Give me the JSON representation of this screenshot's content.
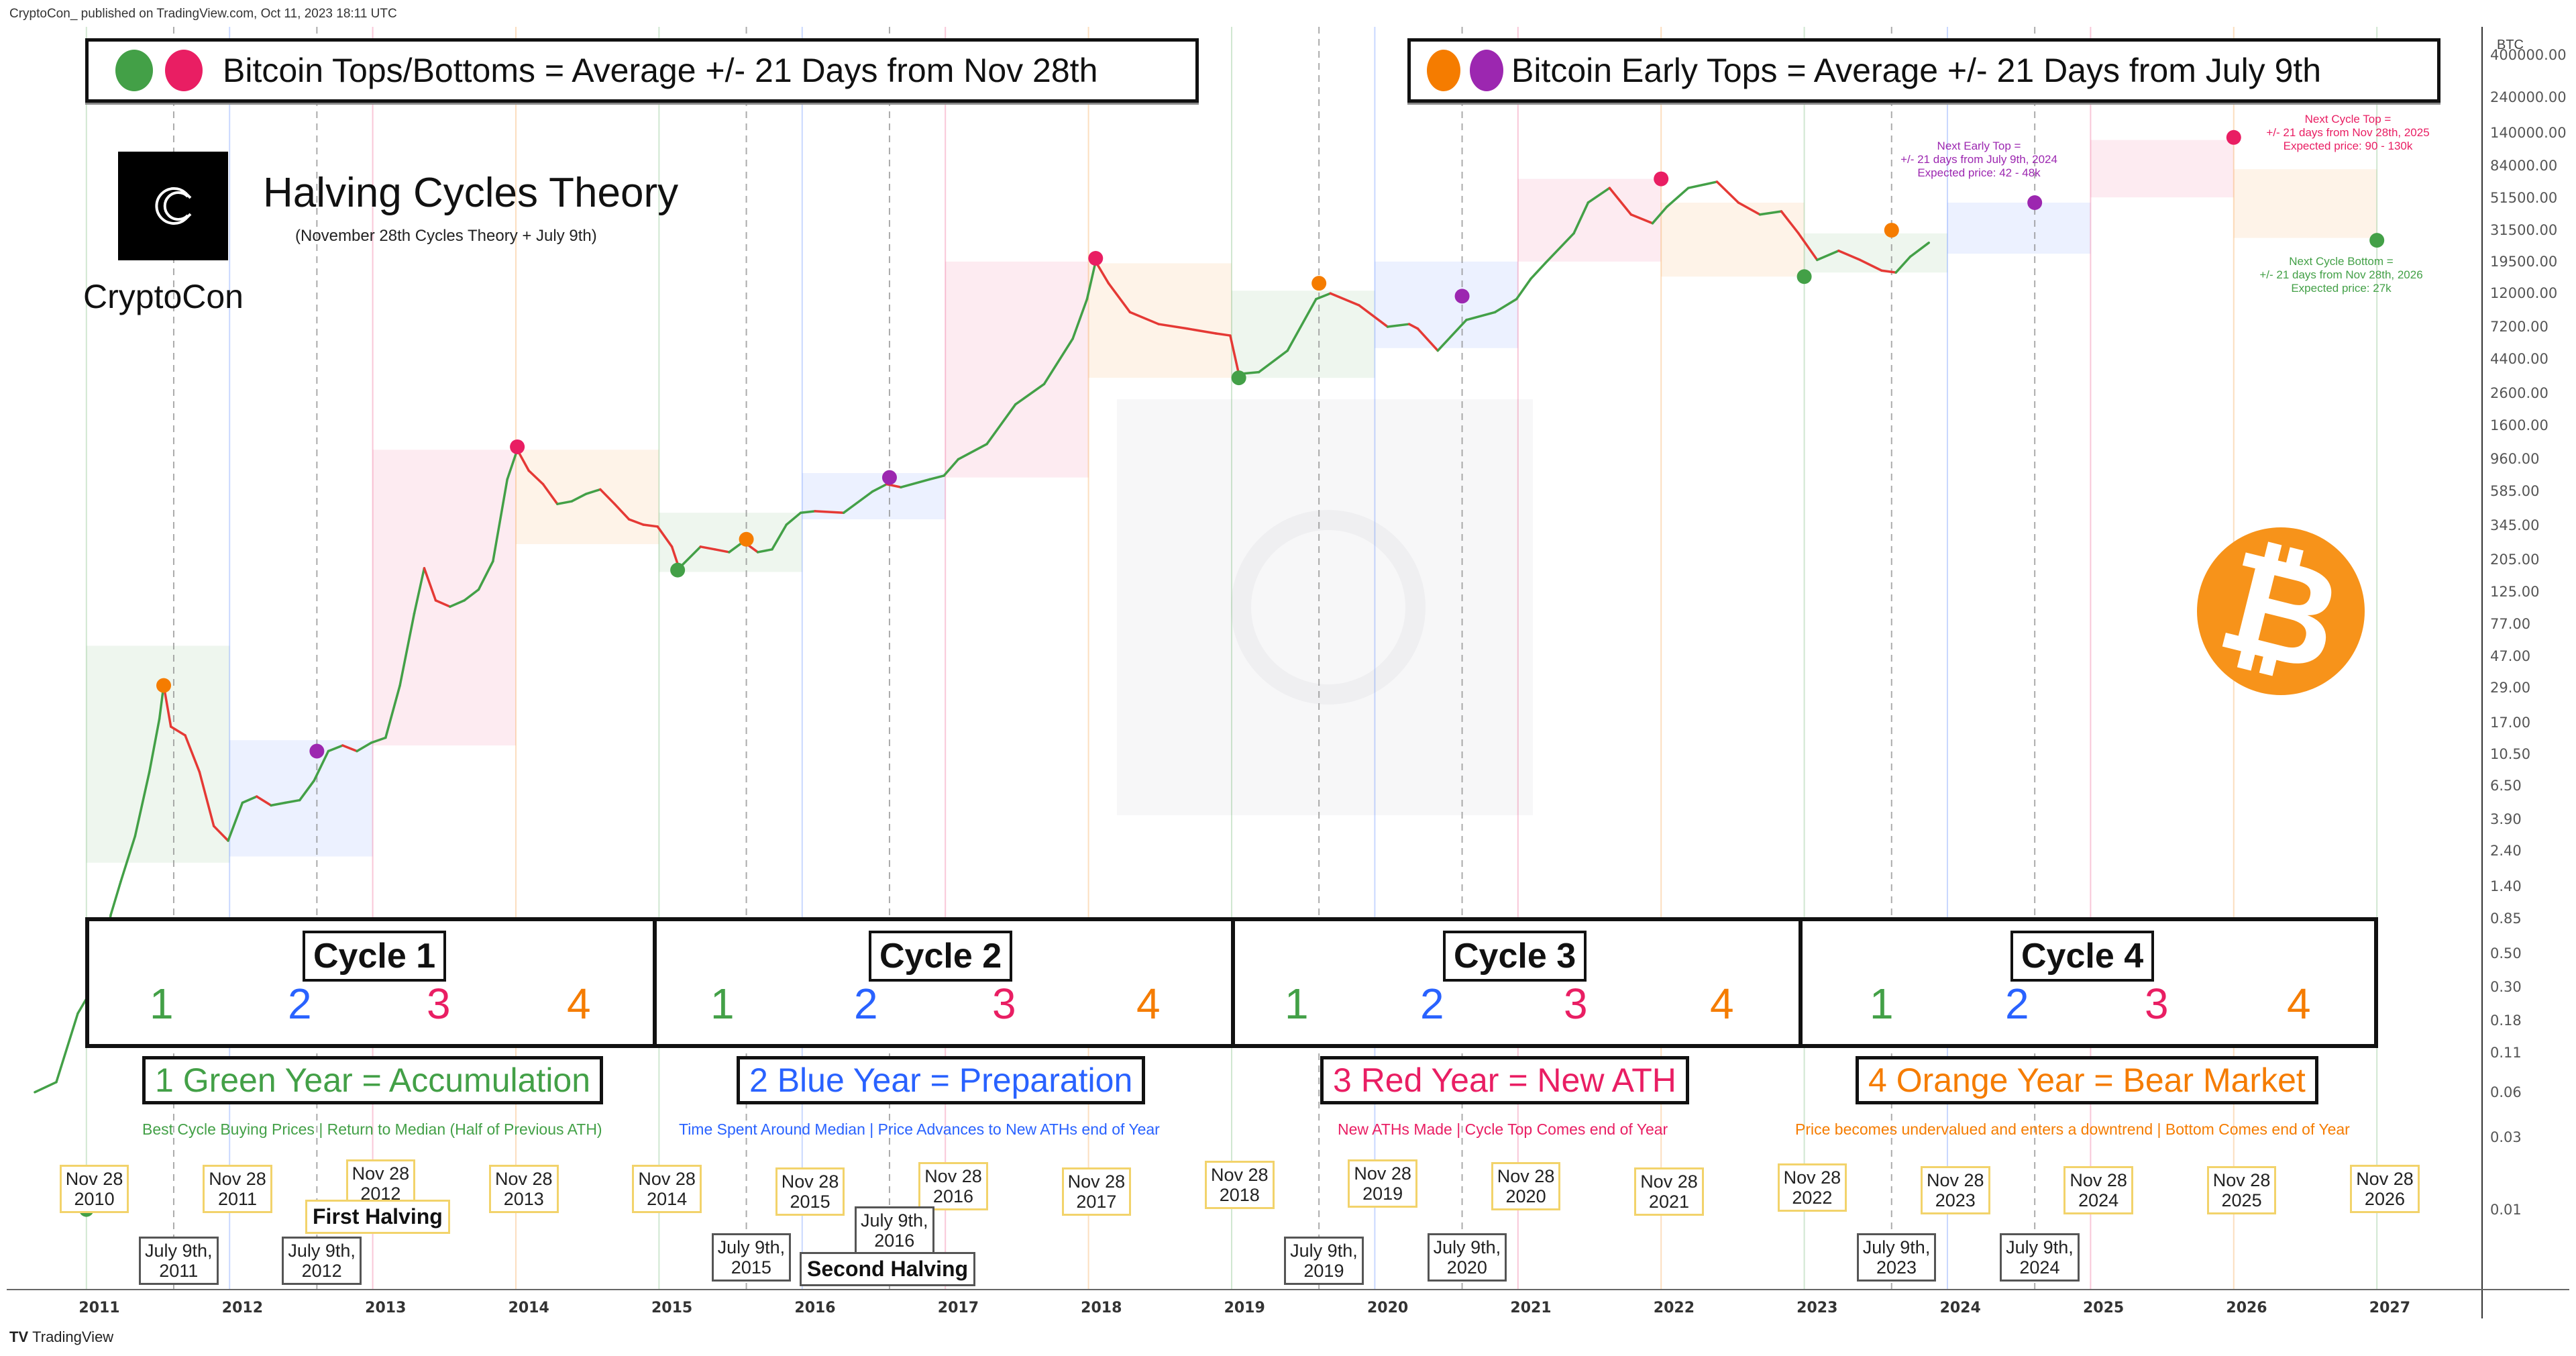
{
  "header": {
    "publisher_line": "CryptoCon_ published on TradingView.com, Oct 11, 2023 18:11 UTC",
    "footer_brand": "TradingView",
    "footer_logo_icon": "tradingview-logo-icon"
  },
  "legends": {
    "tops_bottoms": {
      "text": "Bitcoin Tops/Bottoms = Average +/- 21 Days from Nov 28th",
      "dot_colors": [
        "#43a047",
        "#e91e63"
      ]
    },
    "early_tops": {
      "text": "Bitcoin  Early Tops = Average +/- 21 Days from July 9th",
      "dot_colors": [
        "#f57c00",
        "#9c27b0"
      ]
    }
  },
  "branding": {
    "logo_icon": "cryptocon-logo-icon",
    "name": "CryptoCon",
    "title": "Halving Cycles Theory",
    "subtitle": "(November 28th Cycles Theory + July 9th)",
    "bitcoin_icon": "bitcoin-logo-icon",
    "bitcoin_glyph": "₿"
  },
  "colors": {
    "green": "#43a047",
    "blue": "#2962ff",
    "red": "#e91e63",
    "orange": "#f57c00",
    "purple": "#9c27b0",
    "up_candle": "#26a69a",
    "down_candle": "#ef5350"
  },
  "cycles": [
    {
      "label": "Cycle 1",
      "phases": [
        "1",
        "2",
        "3",
        "4"
      ]
    },
    {
      "label": "Cycle 2",
      "phases": [
        "1",
        "2",
        "3",
        "4"
      ]
    },
    {
      "label": "Cycle 3",
      "phases": [
        "1",
        "2",
        "3",
        "4"
      ]
    },
    {
      "label": "Cycle 4",
      "phases": [
        "1",
        "2",
        "3",
        "4"
      ]
    }
  ],
  "year_types": [
    {
      "title": "1 Green Year = Accumulation",
      "desc": "Best Cycle Buying Prices | Return to Median (Half of Previous ATH)",
      "color": "#43a047"
    },
    {
      "title": "2 Blue Year = Preparation",
      "desc": "Time Spent Around Median | Price Advances to New ATHs end of Year",
      "color": "#2962ff"
    },
    {
      "title": "3 Red Year = New ATH",
      "desc": "New ATHs Made | Cycle Top Comes end of Year",
      "color": "#e91e63"
    },
    {
      "title": "4 Orange Year = Bear Market",
      "desc": "Price becomes undervalued and enters a downtrend | Bottom Comes end of Year",
      "color": "#f57c00"
    }
  ],
  "nov28_labels": [
    {
      "line1": "Nov 28",
      "line2": "2010"
    },
    {
      "line1": "Nov 28",
      "line2": "2011"
    },
    {
      "line1": "Nov 28",
      "line2": "2012"
    },
    {
      "line1": "Nov 28",
      "line2": "2013"
    },
    {
      "line1": "Nov 28",
      "line2": "2014"
    },
    {
      "line1": "Nov 28",
      "line2": "2015"
    },
    {
      "line1": "Nov 28",
      "line2": "2016"
    },
    {
      "line1": "Nov 28",
      "line2": "2017"
    },
    {
      "line1": "Nov 28",
      "line2": "2018"
    },
    {
      "line1": "Nov 28",
      "line2": "2019"
    },
    {
      "line1": "Nov 28",
      "line2": "2020"
    },
    {
      "line1": "Nov 28",
      "line2": "2021"
    },
    {
      "line1": "Nov 28",
      "line2": "2022"
    },
    {
      "line1": "Nov 28",
      "line2": "2023"
    },
    {
      "line1": "Nov 28",
      "line2": "2024"
    },
    {
      "line1": "Nov 28",
      "line2": "2025"
    },
    {
      "line1": "Nov 28",
      "line2": "2026"
    }
  ],
  "july9_labels": [
    {
      "line1": "July 9th,",
      "line2": "2011"
    },
    {
      "line1": "July 9th,",
      "line2": "2012"
    },
    {
      "line1": "July 9th,",
      "line2": "2015"
    },
    {
      "line1": "July 9th,",
      "line2": "2016"
    },
    {
      "line1": "July 9th,",
      "line2": "2019"
    },
    {
      "line1": "July 9th,",
      "line2": "2020"
    },
    {
      "line1": "July 9th,",
      "line2": "2023"
    },
    {
      "line1": "July 9th,",
      "line2": "2024"
    }
  ],
  "halvings": [
    {
      "label": "First Halving"
    },
    {
      "label": "Second Halving"
    }
  ],
  "projections": {
    "next_early_top": {
      "line1": "Next Early Top =",
      "line2": "+/- 21 days from July 9th, 2024",
      "line3": "Expected price: 42 - 48k"
    },
    "next_cycle_top": {
      "line1": "Next Cycle Top =",
      "line2": "+/- 21 days from Nov 28th, 2025",
      "line3": "Expected price: 90 - 130k"
    },
    "next_cycle_bottom": {
      "line1": "Next Cycle Bottom =",
      "line2": "+/- 21 days from Nov 28th, 2026",
      "line3": "Expected price: 27k"
    }
  },
  "chart_data": {
    "type": "line",
    "title": "Halving Cycles Theory",
    "subtitle": "(November 28th Cycles Theory + July 9th)",
    "xlabel": "",
    "ylabel": "BTC",
    "y_scale": "log",
    "ylim": [
      0.01,
      400000
    ],
    "xlim": [
      2010.5,
      2027.6
    ],
    "grid": true,
    "x_ticks": [
      "2011",
      "2012",
      "2013",
      "2014",
      "2015",
      "2016",
      "2017",
      "2018",
      "2019",
      "2020",
      "2021",
      "2022",
      "2023",
      "2024",
      "2025",
      "2026",
      "2027"
    ],
    "y_ticks": [
      "400000.00",
      "240000.00",
      "140000.00",
      "84000.00",
      "51500.00",
      "31500.00",
      "19500.00",
      "12000.00",
      "7200.00",
      "4400.00",
      "2600.00",
      "1600.00",
      "960.00",
      "585.00",
      "345.00",
      "205.00",
      "125.00",
      "77.00",
      "47.00",
      "29.00",
      "17.00",
      "10.50",
      "6.50",
      "3.90",
      "2.40",
      "1.40",
      "0.85",
      "0.50",
      "0.30",
      "0.18",
      "0.11",
      "0.06",
      "0.03",
      "0.01"
    ],
    "y_tick_values": [
      400000,
      240000,
      140000,
      84000,
      51500,
      31500,
      19500,
      12000,
      7200,
      4400,
      2600,
      1600,
      960,
      585,
      345,
      205,
      125,
      77,
      47,
      29,
      17,
      10.5,
      6.5,
      3.9,
      2.4,
      1.4,
      0.85,
      0.5,
      0.3,
      0.18,
      0.11,
      0.06,
      0.03,
      0.01
    ],
    "series": [
      {
        "name": "BTC price",
        "x": [
          2010.55,
          2010.7,
          2010.85,
          2010.91,
          2011.0,
          2011.08,
          2011.15,
          2011.25,
          2011.35,
          2011.42,
          2011.45,
          2011.5,
          2011.6,
          2011.7,
          2011.8,
          2011.9,
          2012.0,
          2012.1,
          2012.2,
          2012.3,
          2012.4,
          2012.5,
          2012.6,
          2012.7,
          2012.8,
          2012.9,
          2013.0,
          2013.1,
          2013.2,
          2013.27,
          2013.35,
          2013.45,
          2013.55,
          2013.65,
          2013.75,
          2013.85,
          2013.92,
          2014.0,
          2014.1,
          2014.2,
          2014.3,
          2014.4,
          2014.5,
          2014.6,
          2014.7,
          2014.8,
          2014.9,
          2015.0,
          2015.05,
          2015.2,
          2015.3,
          2015.4,
          2015.5,
          2015.6,
          2015.7,
          2015.8,
          2015.9,
          2016.0,
          2016.2,
          2016.4,
          2016.5,
          2016.6,
          2016.8,
          2016.9,
          2017.0,
          2017.2,
          2017.4,
          2017.6,
          2017.8,
          2017.9,
          2017.96,
          2018.05,
          2018.2,
          2018.4,
          2018.6,
          2018.8,
          2018.9,
          2018.96,
          2019.1,
          2019.3,
          2019.5,
          2019.6,
          2019.8,
          2020.0,
          2020.15,
          2020.21,
          2020.35,
          2020.55,
          2020.75,
          2020.9,
          2021.0,
          2021.1,
          2021.3,
          2021.4,
          2021.55,
          2021.7,
          2021.85,
          2021.95,
          2022.1,
          2022.3,
          2022.45,
          2022.6,
          2022.75,
          2022.87,
          2023.0,
          2023.15,
          2023.3,
          2023.45,
          2023.55,
          2023.65,
          2023.78
        ],
        "values": [
          0.06,
          0.07,
          0.2,
          0.25,
          0.3,
          0.9,
          1.5,
          3,
          8,
          18,
          30,
          16,
          14,
          8,
          3.5,
          2.8,
          5,
          5.5,
          4.8,
          5,
          5.2,
          7,
          11,
          12,
          11,
          12.5,
          13.5,
          30,
          90,
          180,
          110,
          100,
          110,
          130,
          200,
          700,
          1100,
          800,
          650,
          480,
          500,
          560,
          600,
          480,
          380,
          350,
          340,
          250,
          180,
          250,
          240,
          230,
          270,
          230,
          240,
          350,
          420,
          430,
          420,
          580,
          650,
          620,
          700,
          740,
          950,
          1200,
          2200,
          3000,
          6000,
          11000,
          19500,
          14000,
          9000,
          7500,
          7000,
          6500,
          6300,
          3500,
          3600,
          5000,
          11000,
          12000,
          10000,
          7200,
          7500,
          7000,
          5000,
          8000,
          9000,
          11000,
          15000,
          19000,
          30000,
          48000,
          60000,
          40000,
          35000,
          45000,
          60000,
          66000,
          48000,
          40000,
          42000,
          30000,
          20000,
          23000,
          20000,
          17000,
          16500,
          21000,
          26000,
          28000,
          30000,
          29000,
          27000
        ]
      }
    ],
    "markers": [
      {
        "x": 2010.91,
        "y": 0.01,
        "type": "cycle_bottom",
        "color": "#43a047"
      },
      {
        "x": 2011.45,
        "y": 30,
        "type": "early_top",
        "color": "#f57c00"
      },
      {
        "x": 2012.52,
        "y": 11,
        "type": "early_top",
        "color": "#9c27b0"
      },
      {
        "x": 2013.92,
        "y": 1150,
        "type": "cycle_top",
        "color": "#e91e63"
      },
      {
        "x": 2015.04,
        "y": 175,
        "type": "cycle_bottom",
        "color": "#43a047"
      },
      {
        "x": 2015.52,
        "y": 280,
        "type": "early_top",
        "color": "#f57c00"
      },
      {
        "x": 2016.52,
        "y": 720,
        "type": "early_top",
        "color": "#9c27b0"
      },
      {
        "x": 2017.96,
        "y": 20500,
        "type": "cycle_top",
        "color": "#e91e63"
      },
      {
        "x": 2018.96,
        "y": 3300,
        "type": "cycle_bottom",
        "color": "#43a047"
      },
      {
        "x": 2019.52,
        "y": 14000,
        "type": "early_top",
        "color": "#f57c00"
      },
      {
        "x": 2020.52,
        "y": 11500,
        "type": "early_top",
        "color": "#9c27b0"
      },
      {
        "x": 2021.91,
        "y": 69000,
        "type": "cycle_top",
        "color": "#e91e63"
      },
      {
        "x": 2022.91,
        "y": 15500,
        "type": "cycle_bottom",
        "color": "#43a047"
      },
      {
        "x": 2023.52,
        "y": 31500,
        "type": "early_top",
        "color": "#f57c00"
      },
      {
        "x": 2024.52,
        "y": 48000,
        "type": "early_top_projected",
        "color": "#9c27b0"
      },
      {
        "x": 2025.91,
        "y": 130000,
        "type": "cycle_top_projected",
        "color": "#e91e63"
      },
      {
        "x": 2026.91,
        "y": 27000,
        "type": "cycle_bottom_projected",
        "color": "#43a047"
      }
    ],
    "phase_zones": [
      {
        "x0": 2010.91,
        "x1": 2011.91,
        "y0": 2,
        "y1": 55,
        "color": "#43a047"
      },
      {
        "x0": 2011.91,
        "x1": 2012.91,
        "y0": 2.2,
        "y1": 13,
        "color": "#2962ff"
      },
      {
        "x0": 2012.91,
        "x1": 2013.91,
        "y0": 12,
        "y1": 1100,
        "color": "#e91e63"
      },
      {
        "x0": 2013.91,
        "x1": 2014.91,
        "y0": 260,
        "y1": 1100,
        "color": "#f57c00"
      },
      {
        "x0": 2014.91,
        "x1": 2015.91,
        "y0": 170,
        "y1": 420,
        "color": "#43a047"
      },
      {
        "x0": 2015.91,
        "x1": 2016.91,
        "y0": 380,
        "y1": 770,
        "color": "#2962ff"
      },
      {
        "x0": 2016.91,
        "x1": 2017.91,
        "y0": 720,
        "y1": 19500,
        "color": "#e91e63"
      },
      {
        "x0": 2017.91,
        "x1": 2018.91,
        "y0": 3300,
        "y1": 19000,
        "color": "#f57c00"
      },
      {
        "x0": 2018.91,
        "x1": 2019.91,
        "y0": 3300,
        "y1": 12500,
        "color": "#43a047"
      },
      {
        "x0": 2019.91,
        "x1": 2020.91,
        "y0": 5200,
        "y1": 19500,
        "color": "#2962ff"
      },
      {
        "x0": 2020.91,
        "x1": 2021.91,
        "y0": 19500,
        "y1": 69000,
        "color": "#e91e63"
      },
      {
        "x0": 2021.91,
        "x1": 2022.91,
        "y0": 15500,
        "y1": 48000,
        "color": "#f57c00"
      },
      {
        "x0": 2022.91,
        "x1": 2023.91,
        "y0": 16500,
        "y1": 30000,
        "color": "#43a047"
      },
      {
        "x0": 2023.91,
        "x1": 2024.91,
        "y0": 22000,
        "y1": 48000,
        "color": "#2962ff"
      },
      {
        "x0": 2024.91,
        "x1": 2025.91,
        "y0": 52000,
        "y1": 125000,
        "color": "#e91e63"
      },
      {
        "x0": 2025.91,
        "x1": 2026.91,
        "y0": 28000,
        "y1": 80000,
        "color": "#f57c00"
      }
    ],
    "nov28_lines": [
      2010.91,
      2011.91,
      2012.91,
      2013.91,
      2014.91,
      2015.91,
      2016.91,
      2017.91,
      2018.91,
      2019.91,
      2020.91,
      2021.91,
      2022.91,
      2023.91,
      2024.91,
      2025.91,
      2026.91
    ],
    "july9_lines": [
      2011.52,
      2012.52,
      2015.52,
      2016.52,
      2019.52,
      2020.52,
      2023.52,
      2024.52
    ],
    "legend": "top"
  }
}
